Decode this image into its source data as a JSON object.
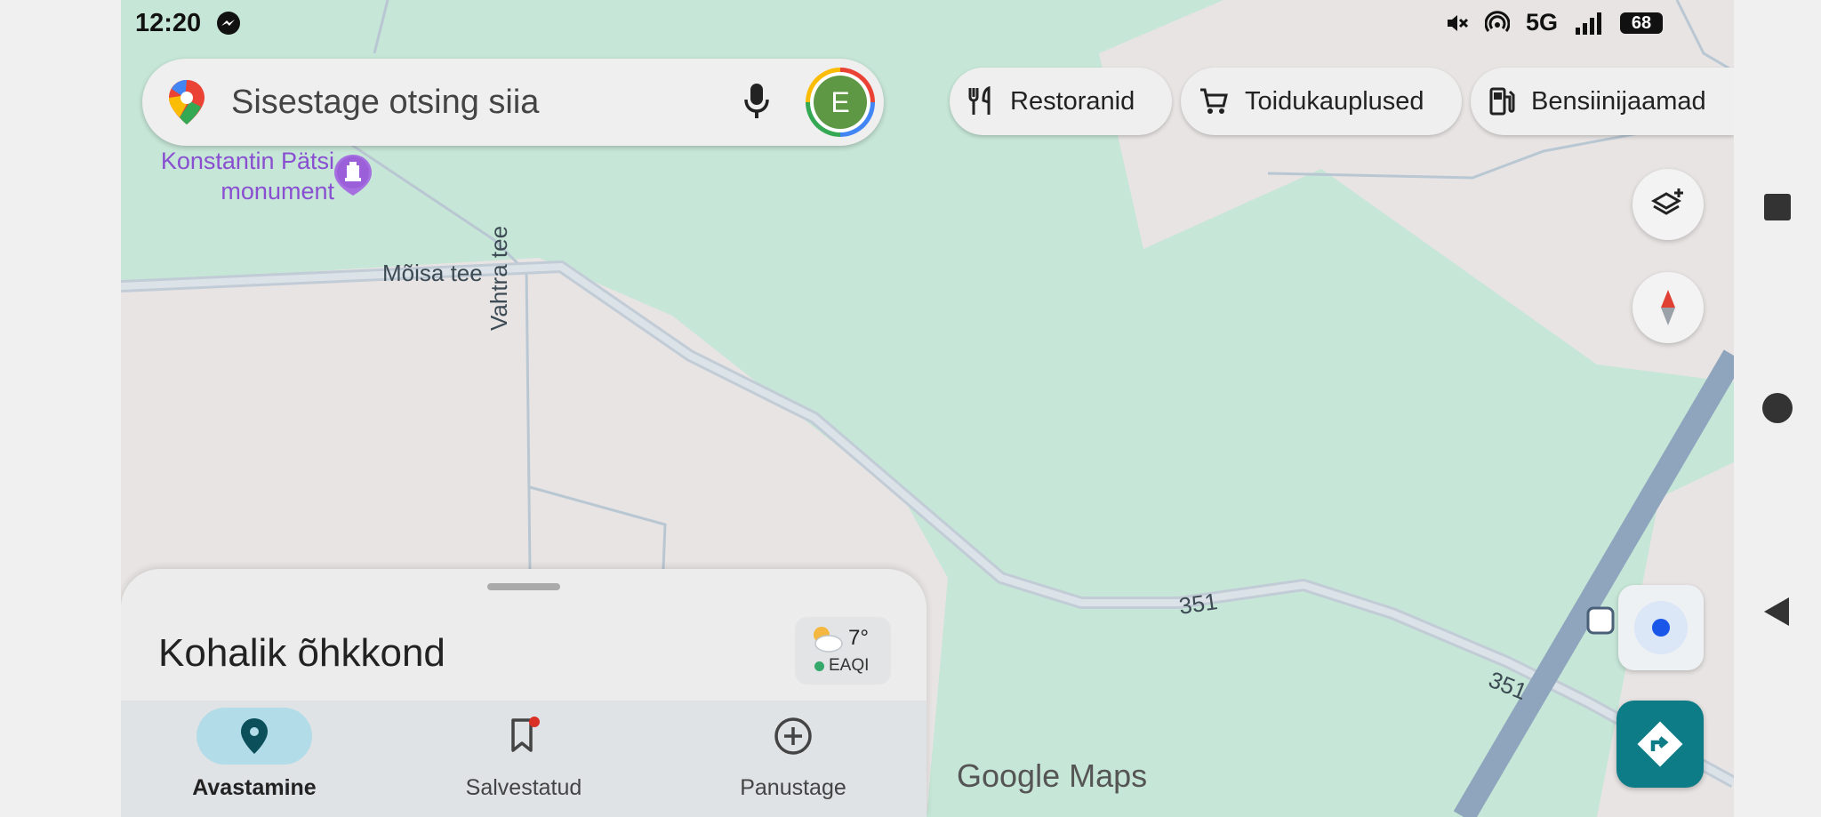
{
  "status_bar": {
    "time": "12:20",
    "network": "5G",
    "battery": "68",
    "icons": [
      "messenger-icon",
      "mute-icon",
      "hotspot-icon",
      "signal-icon",
      "battery-icon"
    ]
  },
  "search": {
    "placeholder": "Sisestage otsing siia",
    "avatar_letter": "E"
  },
  "chips": [
    {
      "label": "Restoranid",
      "icon": "restaurant-icon"
    },
    {
      "label": "Toidukauplused",
      "icon": "cart-icon"
    },
    {
      "label": "Bensiinijaamad",
      "icon": "gas-station-icon"
    }
  ],
  "map": {
    "poi": {
      "name_line1": "Konstantin Pätsi",
      "name_line2": "monument",
      "icon": "monument-icon",
      "color": "#8a4fd1"
    },
    "street_labels": [
      "Mõisa tee",
      "Vahtra tee",
      "351",
      "351"
    ],
    "brand": "Google Maps",
    "land_color": "#e8e4e4",
    "park_color": "#c6e6d7",
    "road_color": "#a9b9c7",
    "highway_color": "#8fa5bd"
  },
  "controls": {
    "layers_icon": "layers-icon",
    "compass_icon": "compass-icon",
    "location_icon": "my-location-icon",
    "directions_icon": "directions-icon",
    "accent": "#0e7c86"
  },
  "sheet": {
    "title": "Kohalik õhkkond",
    "weather": {
      "temp": "7°",
      "aqi": "EAQI"
    }
  },
  "bottom_nav": [
    {
      "label": "Avastamine",
      "icon": "explore-pin-icon",
      "active": true
    },
    {
      "label": "Salvestatud",
      "icon": "bookmark-icon",
      "active": false
    },
    {
      "label": "Panustage",
      "icon": "add-circle-icon",
      "active": false
    }
  ],
  "system_nav": [
    "recents-button",
    "home-button",
    "back-button"
  ]
}
